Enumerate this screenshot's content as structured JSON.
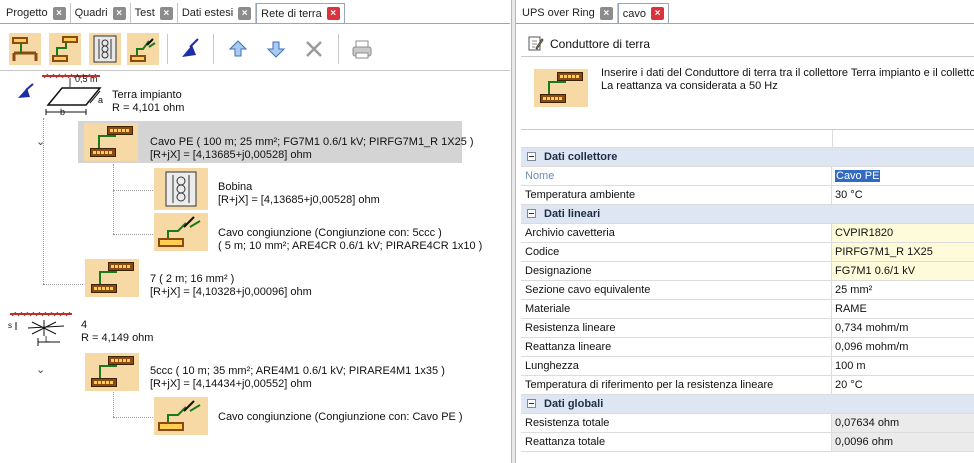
{
  "left_tabs": [
    {
      "label": "Progetto",
      "active": false
    },
    {
      "label": "Quadri",
      "active": false
    },
    {
      "label": "Test",
      "active": false
    },
    {
      "label": "Dati estesi",
      "active": false
    },
    {
      "label": "Rete di terra",
      "active": true
    }
  ],
  "right_tabs": [
    {
      "label": "UPS over Ring",
      "active": false
    },
    {
      "label": "cavo",
      "active": true
    }
  ],
  "toolbar_icons": [
    "conductor-icon",
    "cable-icon",
    "coil-icon",
    "cable-joint-icon",
    "earth-electrode-icon",
    "arrow-up-icon",
    "arrow-down-icon",
    "delete-icon",
    "print-icon"
  ],
  "tree": {
    "plant": {
      "name": "Terra impianto",
      "r": "R = 4,101 ohm",
      "dim1": "0,5 m",
      "dim2": "a",
      "dim3": "b"
    },
    "cable_pe": {
      "line1": "Cavo PE ( 100 m; 25 mm²; FG7M1 0.6/1 kV; PIRFG7M1_R 1X25 )",
      "line2": "[R+jX] = [4,13685+j0,00528] ohm"
    },
    "bobina": {
      "line1": "Bobina",
      "line2": "[R+jX] = [4,13685+j0,00528] ohm"
    },
    "joint1": {
      "line1": "Cavo congiunzione (Congiunzione con: 5ccc )",
      "line2": "( 5 m; 10 mm²; ARE4CR 0.6/1 kV; PIRARE4CR 1x10 )"
    },
    "cable7": {
      "line1": "7 ( 2 m; 16 mm² )",
      "line2": "[R+jX] = [4,10328+j0,00096] ohm"
    },
    "node4": {
      "line1": "4",
      "line2": "R = 4,149 ohm",
      "dim_s": "s",
      "dim_l": "L"
    },
    "cable5": {
      "line1": "5ccc ( 10 m; 35 mm²; ARE4M1 0.6/1 kV; PIRARE4M1 1x35 )",
      "line2": "[R+jX] = [4,14434+j0,00552] ohm"
    },
    "joint2": {
      "line1": "Cavo congiunzione (Congiunzione con: Cavo PE )"
    }
  },
  "panel": {
    "title": "Conduttore di terra",
    "description_line1": "Inserire i dati del Conduttore di terra tra il collettore Terra impianto e il collettore",
    "description_line2": "La reattanza va considerata a 50 Hz"
  },
  "properties": {
    "cat1": "Dati collettore",
    "cat2": "Dati lineari",
    "cat3": "Dati globali",
    "rows": {
      "nome": {
        "k": "Nome",
        "v": "Cavo PE"
      },
      "temp": {
        "k": "Temperatura ambiente",
        "v": "30 °C"
      },
      "archivio": {
        "k": "Archivio cavetteria",
        "v": "CVPIR1820"
      },
      "codice": {
        "k": "Codice",
        "v": "PIRFG7M1_R 1X25"
      },
      "designazione": {
        "k": "Designazione",
        "v": "FG7M1 0.6/1 kV"
      },
      "sezione": {
        "k": "Sezione cavo equivalente",
        "v": "25 mm²"
      },
      "materiale": {
        "k": "Materiale",
        "v": "RAME"
      },
      "resistenza": {
        "k": "Resistenza lineare",
        "v": "0,734 mohm/m"
      },
      "reattanza": {
        "k": "Reattanza lineare",
        "v": "0,096 mohm/m"
      },
      "lunghezza": {
        "k": "Lunghezza",
        "v": "100 m"
      },
      "tempref": {
        "k": "Temperatura di riferimento per la resistenza lineare",
        "v": "20 °C"
      },
      "restot": {
        "k": "Resistenza totale",
        "v": "0,07634 ohm"
      },
      "reatot": {
        "k": "Reattanza totale",
        "v": "0,0096 ohm"
      }
    }
  },
  "colors": {
    "accent": "#316ac5",
    "category_bg": "#dde6f2",
    "close_red": "#d9333b",
    "cable_bg": "#f6d9a4"
  }
}
